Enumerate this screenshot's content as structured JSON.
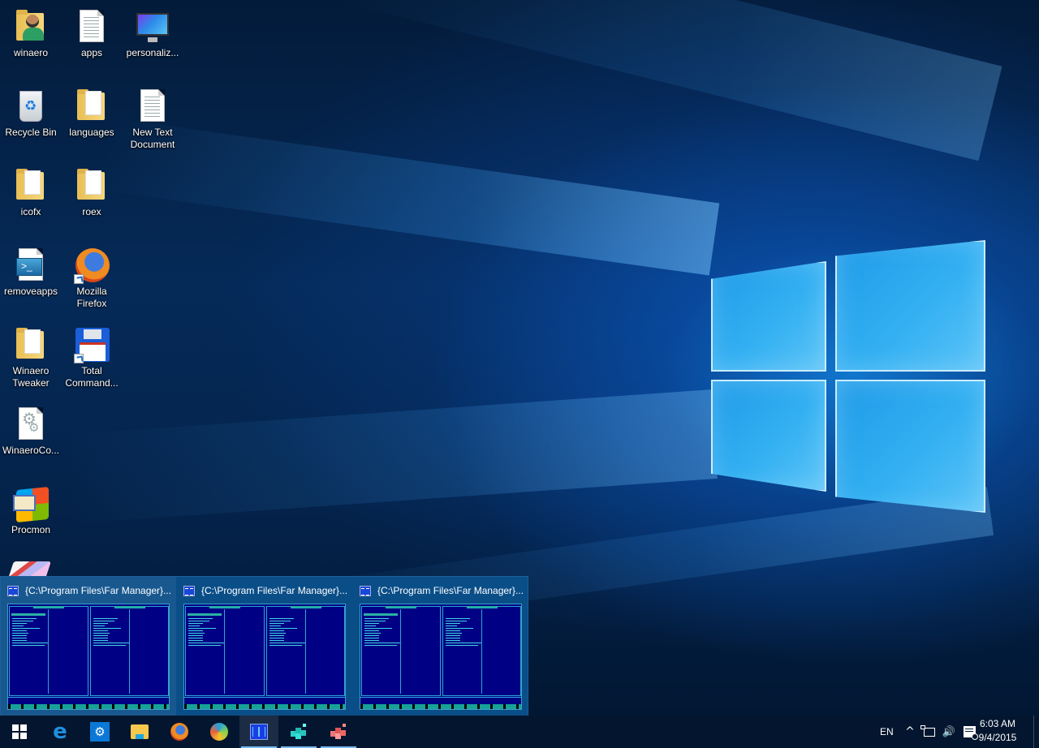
{
  "desktop": {
    "icons": [
      {
        "label": "winaero",
        "icon": "user-folder-icon"
      },
      {
        "label": "apps",
        "icon": "text-document-icon"
      },
      {
        "label": "personaliz...",
        "icon": "personalization-monitor-icon"
      },
      {
        "label": "Recycle Bin",
        "icon": "recycle-bin-icon"
      },
      {
        "label": "languages",
        "icon": "folder-icon"
      },
      {
        "label": "New Text Document",
        "icon": "text-document-icon"
      },
      {
        "label": "icofx",
        "icon": "folder-icon"
      },
      {
        "label": "roex",
        "icon": "folder-icon"
      },
      {
        "label": "removeapps",
        "icon": "powershell-script-icon"
      },
      {
        "label": "Mozilla Firefox",
        "icon": "firefox-icon"
      },
      {
        "label": "Winaero Tweaker",
        "icon": "folder-icon"
      },
      {
        "label": "Total Command...",
        "icon": "total-commander-icon"
      },
      {
        "label": "WinaeroCo...",
        "icon": "config-file-icon"
      },
      {
        "label": "Procmon",
        "icon": "procmon-icon"
      }
    ]
  },
  "preview": {
    "windows": [
      {
        "title": "{C:\\Program Files\\Far Manager}..."
      },
      {
        "title": "{C:\\Program Files\\Far Manager}..."
      },
      {
        "title": "{C:\\Program Files\\Far Manager}..."
      }
    ]
  },
  "taskbar": {
    "buttons": [
      {
        "name": "start-button",
        "icon": "windows-logo-icon"
      },
      {
        "name": "edge-button",
        "icon": "edge-icon"
      },
      {
        "name": "settings-button",
        "icon": "gear-icon",
        "glyph": "⚙"
      },
      {
        "name": "file-explorer-button",
        "icon": "folder-icon"
      },
      {
        "name": "firefox-button",
        "icon": "firefox-icon"
      },
      {
        "name": "swirl-app-button",
        "icon": "swirl-icon"
      },
      {
        "name": "far-manager-button",
        "icon": "far-manager-icon"
      },
      {
        "name": "regedit-cyan-button",
        "icon": "registry-editor-icon"
      },
      {
        "name": "regedit-red-button",
        "icon": "registry-editor-icon"
      }
    ],
    "tray": {
      "language": "EN",
      "chevron": "^",
      "network_icon": "network-icon",
      "volume_glyph": "🔊",
      "action_center_icon": "action-center-icon"
    },
    "clock": {
      "time": "6:03 AM",
      "date": "9/4/2015"
    }
  },
  "colors": {
    "taskbar_bg": "#04162f",
    "preview_bg": "#0a4e88",
    "far_blue": "#000084",
    "accent": "#76b9ed"
  }
}
